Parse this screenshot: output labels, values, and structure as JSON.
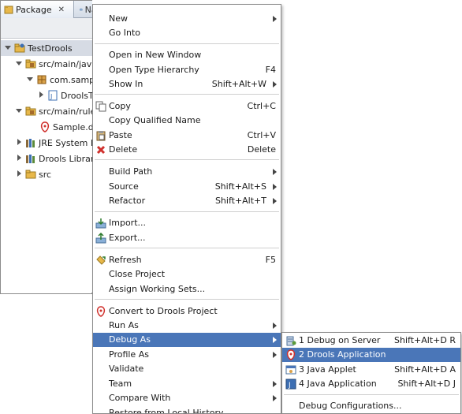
{
  "view": {
    "active_tab": "Package",
    "close_glyph": "✕",
    "inactive_tab": "Navigate"
  },
  "tree": [
    {
      "label": "TestDrools",
      "twisty": "open",
      "icon": "project-icon",
      "selected": true
    },
    {
      "label": "src/main/java",
      "twisty": "open",
      "icon": "source-folder-icon"
    },
    {
      "label": "com.sample",
      "twisty": "open",
      "icon": "package-icon"
    },
    {
      "label": "DroolsTest",
      "twisty": "closed",
      "icon": "java-file-icon"
    },
    {
      "label": "src/main/rules",
      "twisty": "open",
      "icon": "source-folder-icon"
    },
    {
      "label": "Sample.drl",
      "twisty": "none",
      "icon": "drools-file-icon"
    },
    {
      "label": "JRE System Library",
      "twisty": "closed",
      "icon": "library-icon"
    },
    {
      "label": "Drools Library",
      "twisty": "closed",
      "icon": "library-icon"
    },
    {
      "label": "src",
      "twisty": "closed",
      "icon": "folder-icon"
    }
  ],
  "menu": {
    "new": "New",
    "go_into": "Go Into",
    "open_new_window": "Open in New Window",
    "open_type_hierarchy": "Open Type Hierarchy",
    "open_type_hierarchy_acc": "F4",
    "show_in": "Show In",
    "show_in_acc": "Shift+Alt+W",
    "copy": "Copy",
    "copy_acc": "Ctrl+C",
    "copy_qualified": "Copy Qualified Name",
    "paste": "Paste",
    "paste_acc": "Ctrl+V",
    "delete": "Delete",
    "delete_acc": "Delete",
    "build_path": "Build Path",
    "source": "Source",
    "source_acc": "Shift+Alt+S",
    "refactor": "Refactor",
    "refactor_acc": "Shift+Alt+T",
    "import": "Import...",
    "export": "Export...",
    "refresh": "Refresh",
    "refresh_acc": "F5",
    "close_project": "Close Project",
    "assign_working_sets": "Assign Working Sets...",
    "convert_drools": "Convert to Drools Project",
    "run_as": "Run As",
    "debug_as": "Debug As",
    "profile_as": "Profile As",
    "validate": "Validate",
    "team": "Team",
    "compare_with": "Compare With",
    "restore_local_history": "Restore from Local History..."
  },
  "submenu": {
    "debug_on_server": "1 Debug on Server",
    "debug_on_server_acc": "Shift+Alt+D R",
    "drools_application": "2 Drools Application",
    "java_applet": "3 Java Applet",
    "java_applet_acc": "Shift+Alt+D A",
    "java_application": "4 Java Application",
    "java_application_acc": "Shift+Alt+D J",
    "debug_configurations": "Debug Configurations..."
  },
  "colors": {
    "highlight": "#4a76b8",
    "drools_red": "#d0312d",
    "java_blue": "#3d6fb3",
    "folder_yellow": "#e8b84a"
  }
}
